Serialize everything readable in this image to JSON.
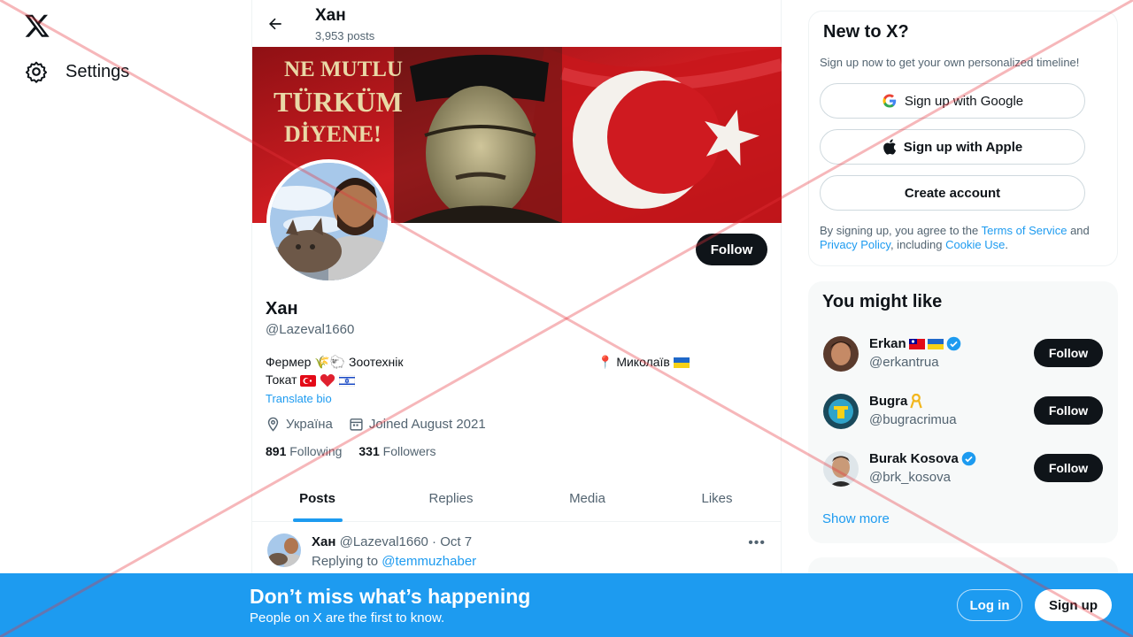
{
  "nav": {
    "settings_label": "Settings"
  },
  "profile": {
    "header_name": "Хан",
    "post_count": "3,953 posts",
    "banner_text": [
      "NE MUTLU",
      "TÜRKÜM",
      "DİYENE!"
    ],
    "follow_label": "Follow",
    "name": "Хан",
    "handle": "@Lazeval1660",
    "bio_line1": "Фермер 🌾🐑 Зоотехнік",
    "bio_location": "📍 Миколаїв",
    "bio_line2": "Токат",
    "translate_label": "Translate bio",
    "location": "Україна",
    "joined": "Joined August 2021",
    "following_count": "891",
    "following_label": "Following",
    "followers_count": "331",
    "followers_label": "Followers"
  },
  "tabs": [
    "Posts",
    "Replies",
    "Media",
    "Likes"
  ],
  "post": {
    "name": "Хан",
    "handle_date": "@Lazeval1660 · Oct 7",
    "replying_prefix": "Replying to",
    "replying_to": "@temmuzhaber"
  },
  "new_to_x": {
    "title": "New to X?",
    "subtitle": "Sign up now to get your own personalized timeline!",
    "google_label": "Sign up with Google",
    "apple_label": "Sign up with Apple",
    "create_label": "Create account",
    "legal_prefix": "By signing up, you agree to the",
    "terms": "Terms of Service",
    "and": "and",
    "privacy": "Privacy Policy",
    "including": ", including",
    "cookie": "Cookie Use",
    "period": "."
  },
  "you_might_like": {
    "title": "You might like",
    "users": [
      {
        "name": "Erkan",
        "handle": "@erkantrua",
        "follow": "Follow"
      },
      {
        "name": "Bugra",
        "handle": "@bugracrimua",
        "follow": "Follow"
      },
      {
        "name": "Burak Kosova",
        "handle": "@brk_kosova",
        "follow": "Follow"
      }
    ],
    "show_more": "Show more"
  },
  "bottom_bar": {
    "title": "Don’t miss what’s happening",
    "subtitle": "People on X are the first to know.",
    "login": "Log in",
    "signup": "Sign up"
  },
  "colors": {
    "accent": "#1d9bf0",
    "text": "#0f1419",
    "muted": "#536471"
  }
}
